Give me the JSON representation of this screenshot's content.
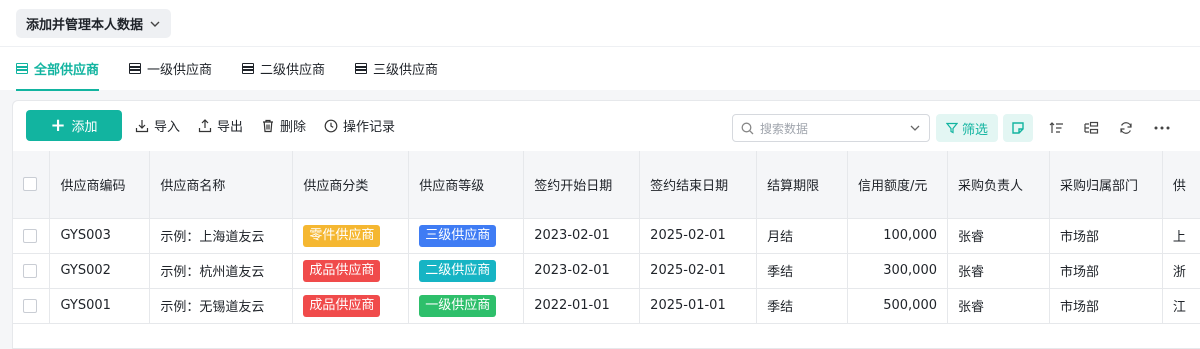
{
  "header": {
    "view_title": "添加并管理本人数据"
  },
  "tabs": [
    {
      "label": "全部供应商",
      "active": true
    },
    {
      "label": "一级供应商",
      "active": false
    },
    {
      "label": "二级供应商",
      "active": false
    },
    {
      "label": "三级供应商",
      "active": false
    }
  ],
  "toolbar": {
    "add_label": "添加",
    "import_label": "导入",
    "export_label": "导出",
    "delete_label": "删除",
    "log_label": "操作记录",
    "search_placeholder": "搜索数据",
    "filter_label": "筛选"
  },
  "colors": {
    "accent": "#12b4a0",
    "tag_yellow": "#f5b731",
    "tag_red": "#f04b4b",
    "tag_blue": "#3f7cf4",
    "tag_cyan": "#16b4c4",
    "tag_green": "#2ebf6b"
  },
  "table": {
    "columns": [
      "供应商编码",
      "供应商名称",
      "供应商分类",
      "供应商等级",
      "签约开始日期",
      "签约结束日期",
      "结算期限",
      "信用额度/元",
      "采购负责人",
      "采购归属部门",
      "供"
    ],
    "rows": [
      {
        "code": "GYS003",
        "name": "示例：上海道友云",
        "category": "零件供应商",
        "category_color": "#f5b731",
        "level": "三级供应商",
        "level_color": "#3f7cf4",
        "start": "2023-02-01",
        "end": "2025-02-01",
        "settle": "月结",
        "credit": "100,000",
        "buyer": "张睿",
        "dept": "市场部",
        "extra": "上"
      },
      {
        "code": "GYS002",
        "name": "示例：杭州道友云",
        "category": "成品供应商",
        "category_color": "#f04b4b",
        "level": "二级供应商",
        "level_color": "#16b4c4",
        "start": "2023-02-01",
        "end": "2025-02-01",
        "settle": "季结",
        "credit": "300,000",
        "buyer": "张睿",
        "dept": "市场部",
        "extra": "浙"
      },
      {
        "code": "GYS001",
        "name": "示例：无锡道友云",
        "category": "成品供应商",
        "category_color": "#f04b4b",
        "level": "一级供应商",
        "level_color": "#2ebf6b",
        "start": "2022-01-01",
        "end": "2025-01-01",
        "settle": "季结",
        "credit": "500,000",
        "buyer": "张睿",
        "dept": "市场部",
        "extra": "江"
      }
    ]
  }
}
